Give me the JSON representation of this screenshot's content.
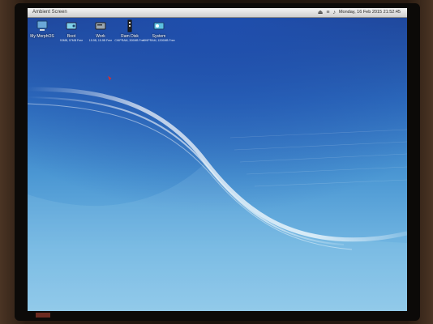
{
  "window": {
    "title": "Ambient Screen"
  },
  "topbar": {
    "clock": "Monday, 16 Feb 2015 21:52:45",
    "tray_icons": [
      "eject-icon",
      "network-icon",
      "volume-icon"
    ]
  },
  "desktop_icons": [
    {
      "label": "My MorphOS",
      "sub": "",
      "icon": "computer-icon"
    },
    {
      "label": "Boot",
      "sub": "93MB, 97MB Free",
      "icon": "harddisk-icon"
    },
    {
      "label": "Work",
      "sub": "15.9B, 15.9B Free",
      "icon": "harddisk-icon"
    },
    {
      "label": "Ram Disk",
      "sub": "CHIPRAM, 300MB Free",
      "icon": "ramdisk-icon"
    },
    {
      "label": "System",
      "sub": "CHIPRAM, 1200MB Free",
      "icon": "system-icon"
    }
  ],
  "colors": {
    "desktop_top": "#1e3f8f",
    "desktop_bottom": "#8cc6e8",
    "topbar": "#e6e6e6"
  }
}
